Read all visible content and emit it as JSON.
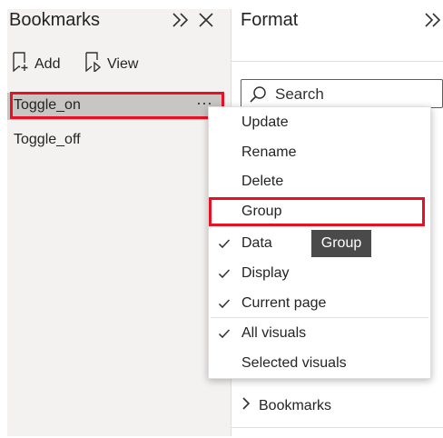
{
  "bookmarks_pane": {
    "title": "Bookmarks",
    "add_label": "Add",
    "view_label": "View",
    "items": [
      {
        "label": "Toggle_on",
        "selected": true
      },
      {
        "label": "Toggle_off",
        "selected": false
      }
    ],
    "more_label": "···"
  },
  "format_pane": {
    "title": "Format",
    "search_placeholder": "Search",
    "bookmarks_section_label": "Bookmarks"
  },
  "context_menu": {
    "items": [
      {
        "label": "Update",
        "checked": false
      },
      {
        "label": "Rename",
        "checked": false
      },
      {
        "label": "Delete",
        "checked": false
      },
      {
        "label": "Group",
        "checked": false
      },
      {
        "label": "Data",
        "checked": true
      },
      {
        "label": "Display",
        "checked": true
      },
      {
        "label": "Current page",
        "checked": true
      },
      {
        "label": "All visuals",
        "checked": true
      },
      {
        "label": "Selected visuals",
        "checked": false
      }
    ]
  },
  "tooltip": {
    "text": "Group"
  },
  "colors": {
    "highlight_outline": "#e81123",
    "selected_row": "#c8c6c4",
    "pane_background": "#f3f2f1",
    "tooltip_background": "#4a4a4a"
  },
  "icons": [
    "chevron-double-right-icon",
    "close-icon",
    "add-bookmark-icon",
    "view-icon",
    "search-icon",
    "chevron-right-icon",
    "checkmark-icon"
  ]
}
